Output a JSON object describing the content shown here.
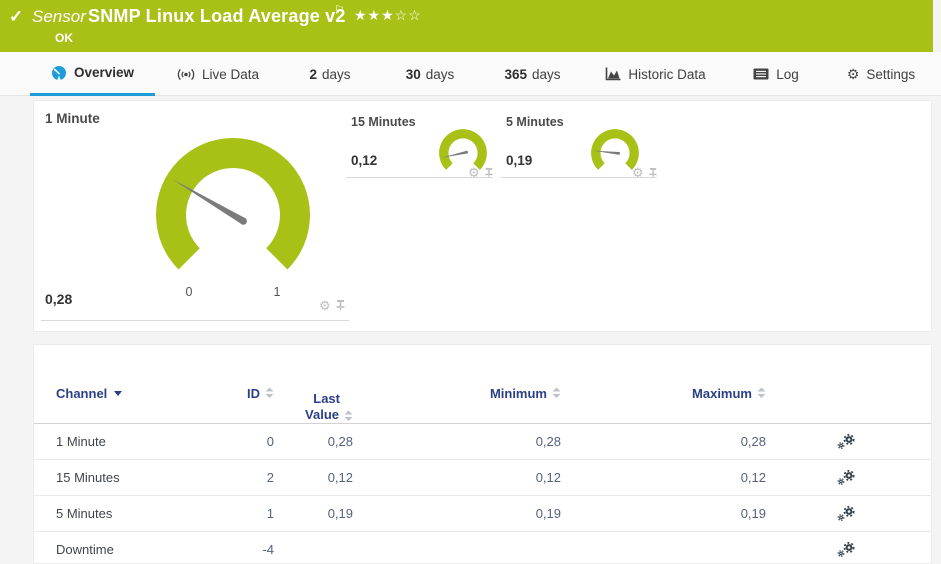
{
  "header": {
    "kind": "Sensor",
    "title": "SNMP Linux Load Average v2",
    "status": "OK",
    "stars_filled": "★★★",
    "stars_empty": "☆☆",
    "priority_stars": {
      "filled": 3,
      "total": 5
    }
  },
  "icons": {
    "check": "✓",
    "flag": "⚐",
    "gear": "⚙"
  },
  "tabs": [
    {
      "label": "Overview",
      "active": true
    },
    {
      "label": "Live Data"
    },
    {
      "number": "2",
      "label": "days"
    },
    {
      "number": "30",
      "label": "days"
    },
    {
      "number": "365",
      "label": "days"
    },
    {
      "label": "Historic Data"
    },
    {
      "label": "Log"
    },
    {
      "label": "Settings"
    }
  ],
  "gauges": {
    "primary": {
      "title": "1 Minute",
      "value": "0,28",
      "value_num": 0.28,
      "scale_min": "0",
      "scale_max": "1"
    },
    "small": [
      {
        "title": "15 Minutes",
        "value": "0,12",
        "value_num": 0.12
      },
      {
        "title": "5 Minutes",
        "value": "0,19",
        "value_num": 0.19
      }
    ]
  },
  "table": {
    "columns": {
      "channel": "Channel",
      "id": "ID",
      "last1": "Last",
      "last2": "Value",
      "minimum": "Minimum",
      "maximum": "Maximum"
    },
    "rows": [
      {
        "channel": "1 Minute",
        "id": "0",
        "last": "0,28",
        "min": "0,28",
        "max": "0,28"
      },
      {
        "channel": "15 Minutes",
        "id": "2",
        "last": "0,12",
        "min": "0,12",
        "max": "0,12"
      },
      {
        "channel": "5 Minutes",
        "id": "1",
        "last": "0,19",
        "min": "0,19",
        "max": "0,19"
      },
      {
        "channel": "Downtime",
        "id": "-4",
        "last": "",
        "min": "",
        "max": ""
      }
    ]
  },
  "colors": {
    "status_green": "#a9c017",
    "accent_blue": "#1e9cd9",
    "table_header_navy": "#2b3f87",
    "needle_gray": "#7b7b7b"
  }
}
